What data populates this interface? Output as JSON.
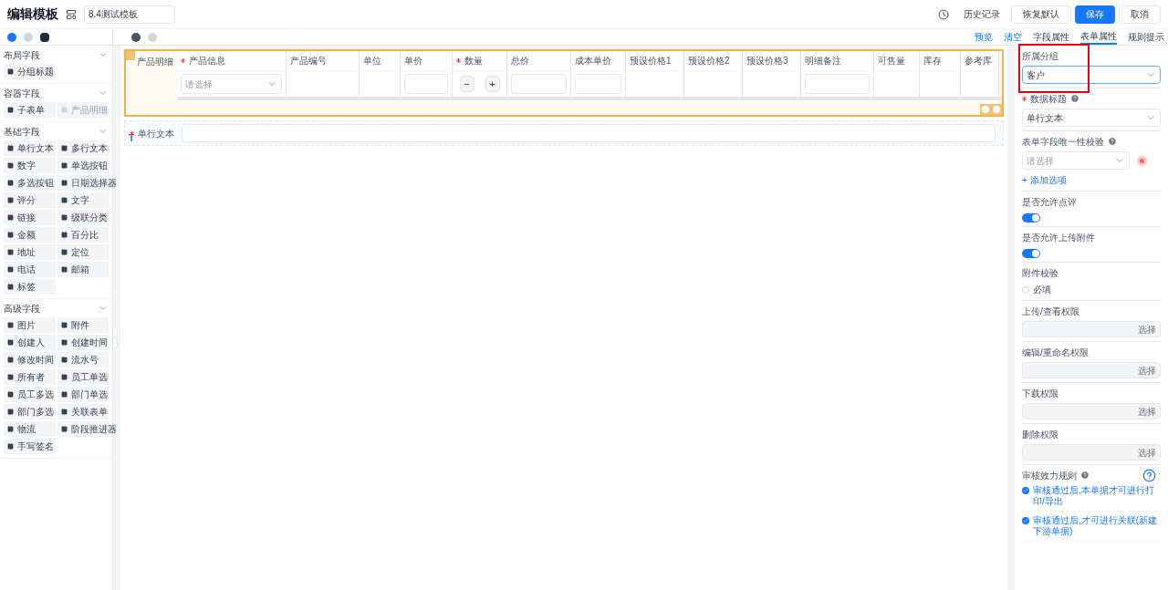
{
  "header": {
    "title": "编辑模板",
    "template_name": "8.4测试模板",
    "history": "历史记录",
    "buttons": [
      {
        "label": "恢复默认",
        "kind": "default"
      },
      {
        "label": "保存",
        "kind": "primary"
      },
      {
        "label": "取消",
        "kind": "default"
      }
    ]
  },
  "palette_tabs": [
    {
      "selected": true
    },
    {
      "selected": false
    },
    {
      "selected": false
    }
  ],
  "palette": [
    {
      "title": "布局字段",
      "expanded": true,
      "items": [
        {
          "label": "分组标题",
          "disabled": false
        }
      ]
    },
    {
      "title": "容器字段",
      "expanded": true,
      "items": [
        {
          "label": "子表单",
          "disabled": false
        },
        {
          "label": "产品明细",
          "disabled": true
        }
      ]
    },
    {
      "title": "基础字段",
      "expanded": true,
      "items": [
        {
          "label": "单行文本",
          "disabled": false
        },
        {
          "label": "多行文本",
          "disabled": false
        },
        {
          "label": "数字",
          "disabled": false
        },
        {
          "label": "单选按钮",
          "disabled": false
        },
        {
          "label": "多选按钮",
          "disabled": false
        },
        {
          "label": "日期选择器",
          "disabled": false
        },
        {
          "label": "评分",
          "disabled": false
        },
        {
          "label": "文字",
          "disabled": false
        },
        {
          "label": "链接",
          "disabled": false
        },
        {
          "label": "级联分类",
          "disabled": false
        },
        {
          "label": "金额",
          "disabled": false
        },
        {
          "label": "百分比",
          "disabled": false
        },
        {
          "label": "地址",
          "disabled": false
        },
        {
          "label": "定位",
          "disabled": false
        },
        {
          "label": "电话",
          "disabled": false
        },
        {
          "label": "邮箱",
          "disabled": false
        },
        {
          "label": "标签",
          "disabled": false
        }
      ]
    },
    {
      "title": "高级字段",
      "expanded": true,
      "items": [
        {
          "label": "图片",
          "disabled": false
        },
        {
          "label": "附件",
          "disabled": false
        },
        {
          "label": "创建人",
          "disabled": false
        },
        {
          "label": "创建时间",
          "disabled": false
        },
        {
          "label": "修改时间",
          "disabled": false
        },
        {
          "label": "流水号",
          "disabled": false
        },
        {
          "label": "所有者",
          "disabled": false
        },
        {
          "label": "员工单选",
          "disabled": false
        },
        {
          "label": "员工多选",
          "disabled": false
        },
        {
          "label": "部门单选",
          "disabled": false
        },
        {
          "label": "部门多选",
          "disabled": false
        },
        {
          "label": "关联表单",
          "disabled": false
        },
        {
          "label": "物流",
          "disabled": false
        },
        {
          "label": "阶段推进器",
          "disabled": false
        },
        {
          "label": "手写签名",
          "disabled": false
        }
      ]
    }
  ],
  "canvas": {
    "product_table": {
      "label": "产品明细",
      "selected": true,
      "columns": [
        {
          "title": "产品信息",
          "required": true,
          "kind": "select",
          "placeholder": "请选择"
        },
        {
          "title": "产品编号",
          "required": false,
          "kind": "empty"
        },
        {
          "title": "单位",
          "required": false,
          "kind": "empty"
        },
        {
          "title": "单价",
          "required": false,
          "kind": "input"
        },
        {
          "title": "数量",
          "required": true,
          "kind": "stepper",
          "minus": "−",
          "plus": "+"
        },
        {
          "title": "总价",
          "required": false,
          "kind": "input"
        },
        {
          "title": "成本单价",
          "required": false,
          "kind": "input"
        },
        {
          "title": "预设价格1",
          "required": false,
          "kind": "empty"
        },
        {
          "title": "预设价格2",
          "required": false,
          "kind": "empty"
        },
        {
          "title": "预设价格3",
          "required": false,
          "kind": "empty"
        },
        {
          "title": "明细备注",
          "required": false,
          "kind": "wide"
        },
        {
          "title": "可售量",
          "required": false,
          "kind": "empty"
        },
        {
          "title": "库存",
          "required": false,
          "kind": "empty"
        },
        {
          "title": "参考库",
          "required": false,
          "kind": "empty"
        }
      ]
    },
    "text_field": {
      "label": "单行文本",
      "required": true,
      "type_mark": "T"
    }
  },
  "right_tabs": [
    {
      "label": "预览",
      "kind": "link",
      "selected": false
    },
    {
      "label": "清空",
      "kind": "link",
      "selected": false
    },
    {
      "label": "字段属性",
      "kind": "tab",
      "selected": false
    },
    {
      "label": "表单属性",
      "kind": "tab",
      "selected": true
    },
    {
      "label": "规则提示",
      "kind": "tab",
      "selected": false
    }
  ],
  "properties": [
    {
      "kind": "select",
      "label": "所属分组",
      "required": false,
      "help": false,
      "value": "客户",
      "highlighted": true
    },
    {
      "kind": "select",
      "label": "数据标题",
      "required": true,
      "help": true,
      "value": "单行文本",
      "highlighted": false
    },
    {
      "kind": "unique",
      "label": "表单字段唯一性校验",
      "required": false,
      "help": true,
      "placeholder": "请选择",
      "add": "+ 添加选项"
    },
    {
      "kind": "toggle",
      "label": "是否允许点评",
      "on": true
    },
    {
      "kind": "toggle",
      "label": "是否允许上传附件",
      "on": true
    },
    {
      "kind": "checkbox",
      "label": "附件校验",
      "option": "必填",
      "checked": false
    },
    {
      "kind": "picker",
      "label": "上传/查看权限",
      "button": "选择"
    },
    {
      "kind": "picker",
      "label": "编辑/重命名权限",
      "button": "选择"
    },
    {
      "kind": "picker",
      "label": "下载权限",
      "button": "选择"
    },
    {
      "kind": "picker",
      "label": "删除权限",
      "button": "选择"
    },
    {
      "kind": "rules",
      "label": "审核效力规则",
      "help": true,
      "options": [
        {
          "label": "审核通过后,本单据才可进行打印/导出",
          "checked": true
        },
        {
          "label": "审核通过后,才可进行关联(新建下游单据)",
          "checked": true
        }
      ]
    }
  ]
}
